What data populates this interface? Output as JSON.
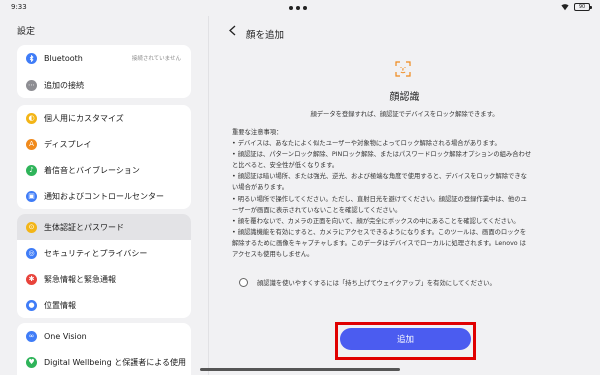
{
  "status_bar": {
    "time": "9:33",
    "battery": "90",
    "icons": [
      "wifi-icon",
      "battery-icon"
    ]
  },
  "sidebar": {
    "title": "設定",
    "groups": [
      {
        "items": [
          {
            "label": "Bluetooth",
            "sub": "接続されていません",
            "icon": "bluetooth-icon",
            "color": "#3f7cf7"
          },
          {
            "label": "追加の接続",
            "icon": "more-connections-icon",
            "color": "#8e8e93"
          }
        ]
      },
      {
        "items": [
          {
            "label": "個人用にカスタマイズ",
            "icon": "customize-icon",
            "color": "#f3b517"
          },
          {
            "label": "ディスプレイ",
            "icon": "display-icon",
            "color": "#f08a1c"
          },
          {
            "label": "着信音とバイブレーション",
            "icon": "sound-icon",
            "color": "#2fb45a"
          },
          {
            "label": "通知およびコントロールセンター",
            "icon": "notification-icon",
            "color": "#3f7cf7"
          }
        ]
      },
      {
        "items": [
          {
            "label": "生体認証とパスワード",
            "icon": "biometric-icon",
            "color": "#f3b517",
            "selected": true
          },
          {
            "label": "セキュリティとプライバシー",
            "icon": "security-icon",
            "color": "#3f7cf7"
          },
          {
            "label": "緊急情報と緊急通報",
            "icon": "emergency-icon",
            "color": "#e8433b"
          },
          {
            "label": "位置情報",
            "icon": "location-icon",
            "color": "#3f7cf7"
          }
        ]
      },
      {
        "items": [
          {
            "label": "One Vision",
            "icon": "one-vision-icon",
            "color": "#3f7cf7"
          },
          {
            "label": "Digital Wellbeing と保護者による使用",
            "icon": "wellbeing-icon",
            "color": "#2fb45a"
          }
        ]
      }
    ]
  },
  "main": {
    "back_icon": "back-arrow-icon",
    "title": "顔を追加",
    "face_icon": "face-scan-icon",
    "face_title": "顔認識",
    "description": "顔データを登録すれば、顔認証でデバイスをロック解除できます。",
    "notes_heading": "重要な注意事項：",
    "notes": [
      "• デバイスは、あなたによく似たユーザーや対象物によってロック解除される場合があります。",
      "• 顔認証は、パターンロック解除、PINロック解除、またはパスワードロック解除オプションの組み合わせ",
      "と比べると、安全性が低くなります。",
      "• 顔認証は暗い場所、または強光、逆光、および極端な角度で使用すると、デバイスをロック解除できな",
      "い場合があります。",
      "• 明るい場所で操作してください。ただし、直射日光を避けてください。顔認証の登録作業中は、他のユ",
      "ーザーが画面に表示されていないことを確認してください。",
      "• 顔を覆わないで、カメラの正面を向いて、顔が完全にボックスの中にあることを確認してください。",
      "• 顔認識機能を有効にすると、カメラにアクセスできるようになります。このツールは、画面のロックを",
      "解除するために画像をキャプチャします。このデータはデバイスでローカルに処理されます。Lenovo は",
      "アクセスも使用もしません。"
    ],
    "option_label": "顔認識を使いやすくするには「持ち上げてウェイクアップ」を有効にしてください。",
    "option_checked": false,
    "add_button": "追加",
    "accent_color": "#4b5cf0",
    "highlight_color": "#e00000"
  }
}
